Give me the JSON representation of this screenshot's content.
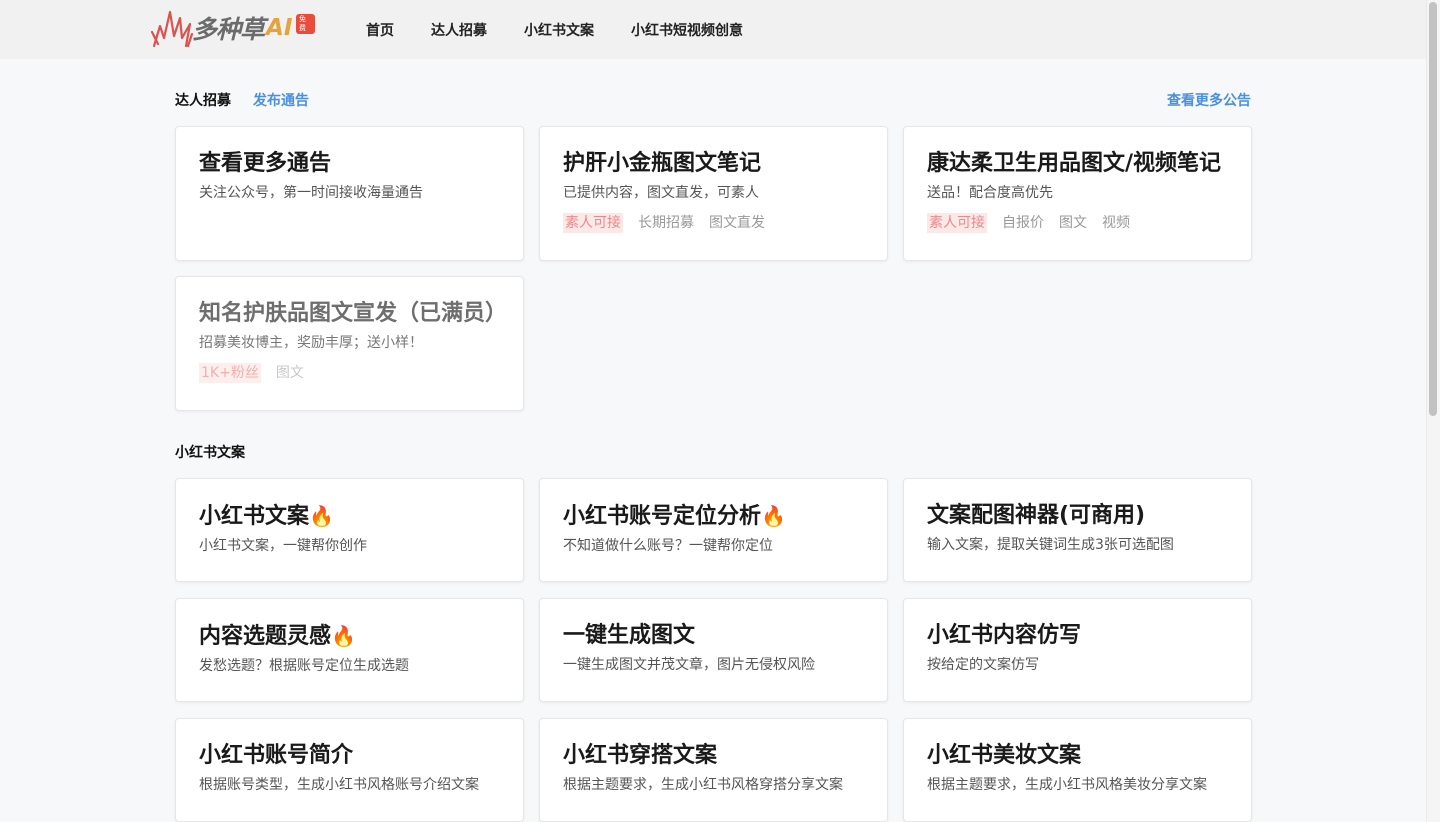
{
  "nav": {
    "logo_text": "多种草",
    "logo_ai": "AI",
    "logo_badge": "免费",
    "items": [
      "首页",
      "达人招募",
      "小红书文案",
      "小红书短视频创意"
    ]
  },
  "recruit": {
    "title": "达人招募",
    "publish_link": "发布通告",
    "more_link": "查看更多公告",
    "cards": [
      {
        "title": "查看更多通告",
        "desc": "关注公众号，第一时间接收海量通告",
        "tags": []
      },
      {
        "title": "护肝小金瓶图文笔记",
        "desc": "已提供内容，图文直发，可素人",
        "tags": [
          "素人可接",
          "长期招募",
          "图文直发"
        ]
      },
      {
        "title": "康达柔卫生用品图文/视频笔记",
        "desc": "送品！配合度高优先",
        "tags": [
          "素人可接",
          "自报价",
          "图文",
          "视频"
        ]
      },
      {
        "title": "知名护肤品图文宣发（已满员）",
        "desc": "招募美妆博主，奖励丰厚；送小样！",
        "tags": [
          "1K+粉丝",
          "图文"
        ]
      }
    ]
  },
  "copy": {
    "title": "小红书文案",
    "cards": [
      {
        "title": "小红书文案",
        "desc": "小红书文案，一键帮你创作",
        "fire": "🔥"
      },
      {
        "title": "小红书账号定位分析",
        "desc": "不知道做什么账号？一键帮你定位",
        "fire": "🔥"
      },
      {
        "title": "文案配图神器(可商用)",
        "desc": "输入文案，提取关键词生成3张可选配图"
      },
      {
        "title": "内容选题灵感",
        "desc": "发愁选题？根据账号定位生成选题",
        "fire": "🔥"
      },
      {
        "title": "一键生成图文",
        "desc": "一键生成图文并茂文章，图片无侵权风险"
      },
      {
        "title": "小红书内容仿写",
        "desc": "按给定的文案仿写"
      },
      {
        "title": "小红书账号简介",
        "desc": "根据账号类型，生成小红书风格账号介绍文案"
      },
      {
        "title": "小红书穿搭文案",
        "desc": "根据主题要求，生成小红书风格穿搭分享文案"
      },
      {
        "title": "小红书美妆文案",
        "desc": "根据主题要求，生成小红书风格美妆分享文案"
      }
    ]
  },
  "colors": {
    "accent": "#4a90e2",
    "hot_tag_bg": "#fde8e8",
    "logo_red": "#d9534f",
    "logo_ai": "#e6a23c"
  }
}
